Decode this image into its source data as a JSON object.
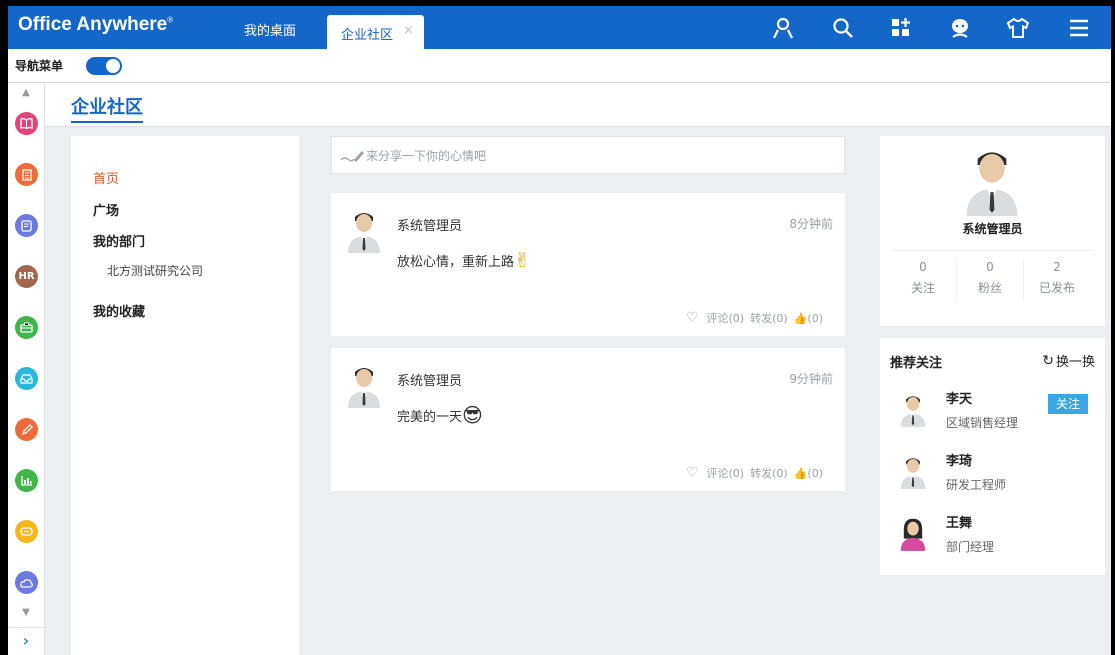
{
  "app": {
    "brand": "Office Anywhere",
    "brand_mark": "®"
  },
  "tabs": [
    {
      "label": "我的桌面",
      "active": false
    },
    {
      "label": "企业社区",
      "active": true,
      "close": "×"
    }
  ],
  "toolbar_icons": [
    "user-icon",
    "search-icon",
    "apps-icon",
    "chat-icon",
    "shirt-icon",
    "menu-icon"
  ],
  "nav_toggle": {
    "label": "导航菜单",
    "on": true
  },
  "rail_icons": [
    {
      "name": "book",
      "color": "#e2437a"
    },
    {
      "name": "building",
      "color": "#ef6c3a"
    },
    {
      "name": "note",
      "color": "#6c79e0"
    },
    {
      "name": "hr",
      "color": "#a2664c",
      "text": "HR"
    },
    {
      "name": "briefcase",
      "color": "#3fb54b"
    },
    {
      "name": "inbox",
      "color": "#2bb8d8"
    },
    {
      "name": "pencil-note",
      "color": "#ef6c3a"
    },
    {
      "name": "chart",
      "color": "#3fb54b"
    },
    {
      "name": "chat-bubble",
      "color": "#f5b818"
    },
    {
      "name": "cloud",
      "color": "#6c79e0"
    }
  ],
  "page_title": "企业社区",
  "menu": {
    "home": "首页",
    "square": "广场",
    "my_department": "我的部门",
    "department_name": "北方测试研究公司",
    "my_favorites": "我的收藏"
  },
  "share_placeholder": "来分享一下你的心情吧",
  "posts": [
    {
      "author": "系统管理员",
      "time": "8分钟前",
      "text": "放松心情，重新上路",
      "emoji": "✌",
      "comment": "评论(0)",
      "forward": "转发(0)",
      "like": "(0)"
    },
    {
      "author": "系统管理员",
      "time": "9分钟前",
      "text": "完美的一天",
      "emoji": "😎",
      "comment": "评论(0)",
      "forward": "转发(0)",
      "like": "(0)"
    }
  ],
  "profile": {
    "name": "系统管理员",
    "stats": [
      {
        "value": "0",
        "label": "关注"
      },
      {
        "value": "0",
        "label": "粉丝"
      },
      {
        "value": "2",
        "label": "已发布"
      }
    ]
  },
  "recommend": {
    "title": "推荐关注",
    "refresh": "换一换",
    "follow": "关注",
    "people": [
      {
        "name": "李天",
        "title": "区域销售经理"
      },
      {
        "name": "李琦",
        "title": "研发工程师"
      },
      {
        "name": "王舞",
        "title": "部门经理"
      }
    ]
  },
  "colors": {
    "primary": "#1467c8",
    "active_menu": "#e65a2c",
    "follow_button": "#3aa7e4"
  }
}
